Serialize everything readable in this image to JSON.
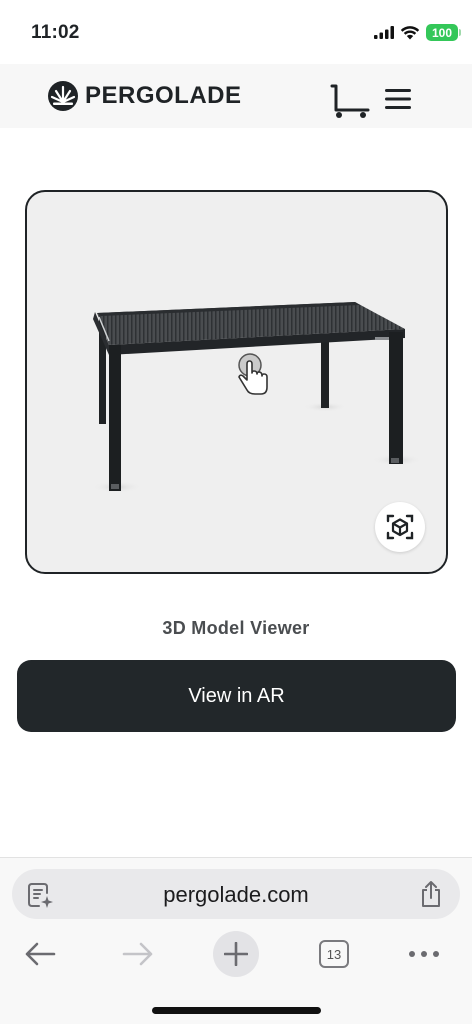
{
  "status_bar": {
    "time": "11:02",
    "battery": "100",
    "icons": [
      "signal-icon",
      "wifi-icon",
      "battery-icon"
    ]
  },
  "header": {
    "brand": "PERGOLADE",
    "icons": [
      "logo-icon",
      "cart-icon",
      "hamburger-menu-icon"
    ]
  },
  "viewer": {
    "title": "3D Model Viewer",
    "button_label": "View in AR",
    "icons": [
      "hand-pointer-icon",
      "ar-cube-icon"
    ]
  },
  "browser": {
    "url": "pergolade.com",
    "tab_count": "13",
    "icons": [
      "reader-icon",
      "share-icon",
      "back-arrow-icon",
      "forward-arrow-icon",
      "plus-icon",
      "tabs-icon",
      "more-icon"
    ]
  },
  "colors": {
    "accent_dark": "#22272a",
    "battery_green": "#34c759",
    "viewer_bg": "#efefef"
  }
}
